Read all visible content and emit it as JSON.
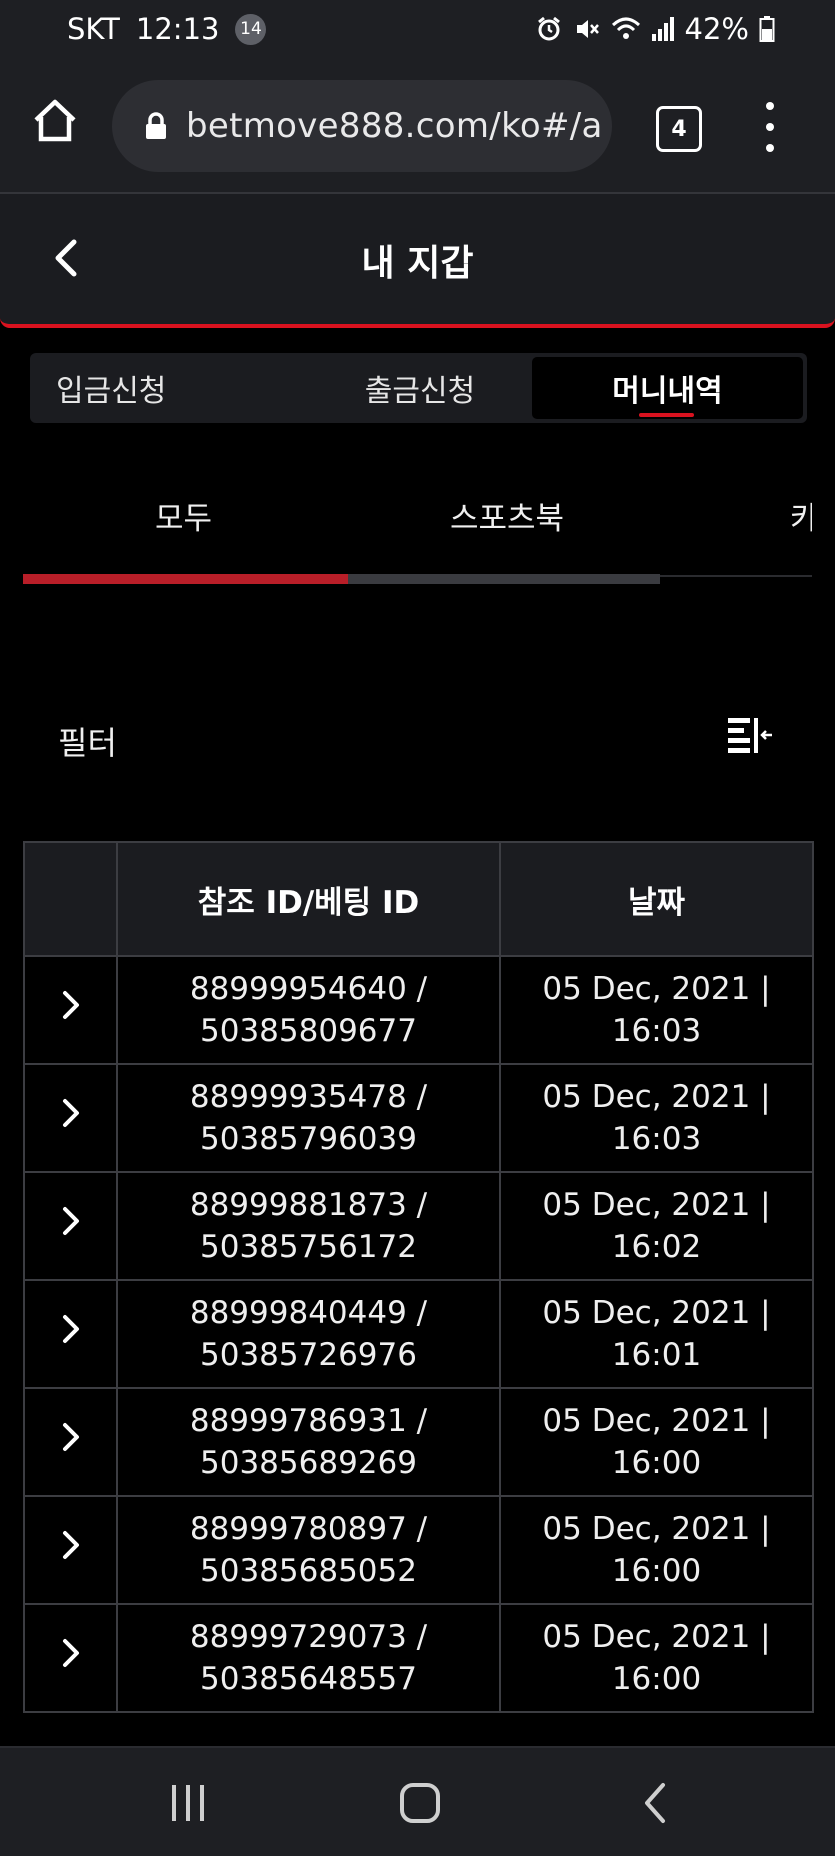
{
  "status_bar": {
    "carrier": "SKT",
    "time": "12:13",
    "notification_count": "14",
    "battery": "42%"
  },
  "browser": {
    "url": "betmove888.com/ko#/a",
    "tab_count": "4"
  },
  "header": {
    "title": "내 지갑"
  },
  "wallet_tabs": [
    {
      "label": "입금신청",
      "active": false
    },
    {
      "label": "출금신청",
      "active": false
    },
    {
      "label": "머니내역",
      "active": true
    }
  ],
  "category_tabs": [
    {
      "label": "모두",
      "active": true
    },
    {
      "label": "스포츠북",
      "active": false
    },
    {
      "label": "카",
      "active": false
    }
  ],
  "filter": {
    "label": "필터"
  },
  "table": {
    "headers": [
      "",
      "참조 ID/베팅 ID",
      "날짜"
    ],
    "rows": [
      {
        "ref_id": "88999954640 /",
        "bet_id": "50385809677",
        "date": "05 Dec, 2021 |",
        "time": "16:03"
      },
      {
        "ref_id": "88999935478 /",
        "bet_id": "50385796039",
        "date": "05 Dec, 2021 |",
        "time": "16:03"
      },
      {
        "ref_id": "88999881873 /",
        "bet_id": "50385756172",
        "date": "05 Dec, 2021 |",
        "time": "16:02"
      },
      {
        "ref_id": "88999840449 /",
        "bet_id": "50385726976",
        "date": "05 Dec, 2021 |",
        "time": "16:01"
      },
      {
        "ref_id": "88999786931 /",
        "bet_id": "50385689269",
        "date": "05 Dec, 2021 |",
        "time": "16:00"
      },
      {
        "ref_id": "88999780897 /",
        "bet_id": "50385685052",
        "date": "05 Dec, 2021 |",
        "time": "16:00"
      },
      {
        "ref_id": "88999729073 /",
        "bet_id": "50385648557",
        "date": "05 Dec, 2021 |",
        "time": "16:00"
      }
    ]
  },
  "icons": {
    "home": "home-icon",
    "lock": "lock-icon",
    "tabs": "tabs-icon",
    "menu": "more-vert-icon",
    "back": "chevron-left-icon",
    "filter": "filter-collapse-icon",
    "row_expand": "chevron-right-icon",
    "nav_recents": "recents-icon",
    "nav_home": "home-button-icon",
    "nav_back": "back-icon"
  },
  "colors": {
    "accent": "#d9121f",
    "background": "#000000",
    "surface": "#1b1c20",
    "border": "#3c3d42"
  }
}
